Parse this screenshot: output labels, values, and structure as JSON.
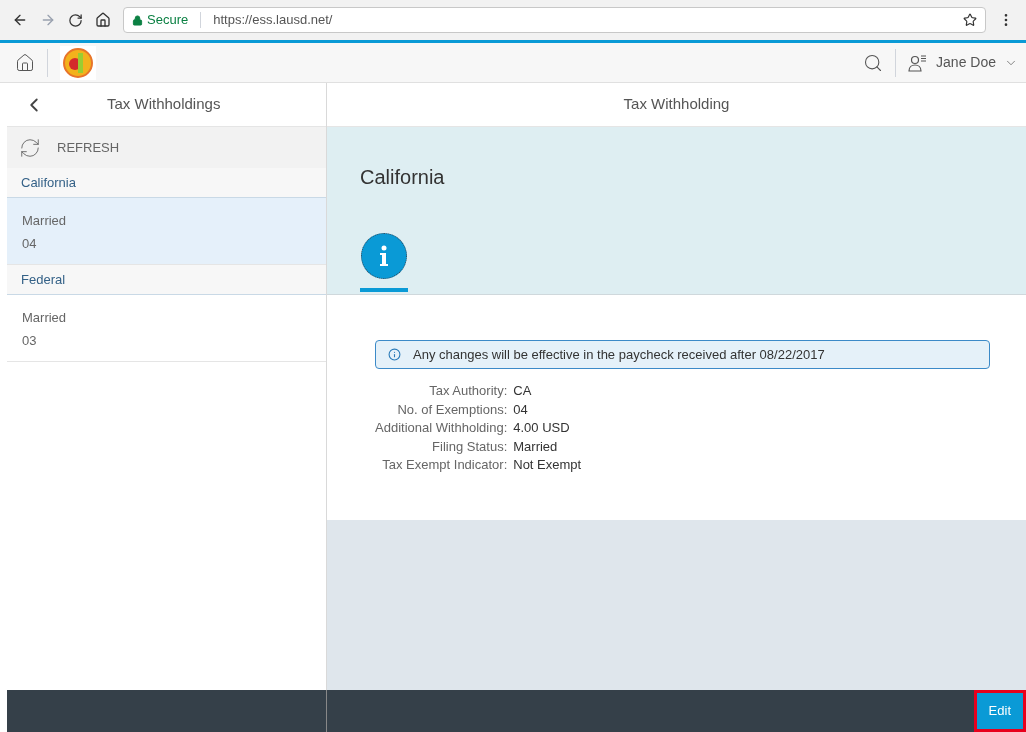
{
  "browser": {
    "secure_label": "Secure",
    "url": "https://ess.lausd.net/"
  },
  "header": {
    "user_name": "Jane Doe"
  },
  "master": {
    "title": "Tax Withholdings",
    "refresh": "REFRESH",
    "groups": [
      {
        "title": "California",
        "items": [
          {
            "title": "Married",
            "subtitle": "04",
            "selected": true
          }
        ]
      },
      {
        "title": "Federal",
        "items": [
          {
            "title": "Married",
            "subtitle": "03",
            "selected": false
          }
        ]
      }
    ]
  },
  "detail": {
    "title": "Tax Withholding",
    "object_title": "California",
    "tabs": [
      {
        "kind": "info",
        "selected": true
      }
    ],
    "message": "Any changes will be effective in the paycheck received after 08/22/2017",
    "fields": [
      {
        "label": "Tax Authority:",
        "value": "CA"
      },
      {
        "label": "No. of Exemptions:",
        "value": "04"
      },
      {
        "label": "Additional Withholding:",
        "value": "4.00 USD"
      },
      {
        "label": "Filing Status:",
        "value": "Married"
      },
      {
        "label": "Tax Exempt Indicator:",
        "value": "Not Exempt"
      }
    ]
  },
  "footer": {
    "buttons": [
      {
        "label": "Edit",
        "highlighted": true
      }
    ]
  }
}
